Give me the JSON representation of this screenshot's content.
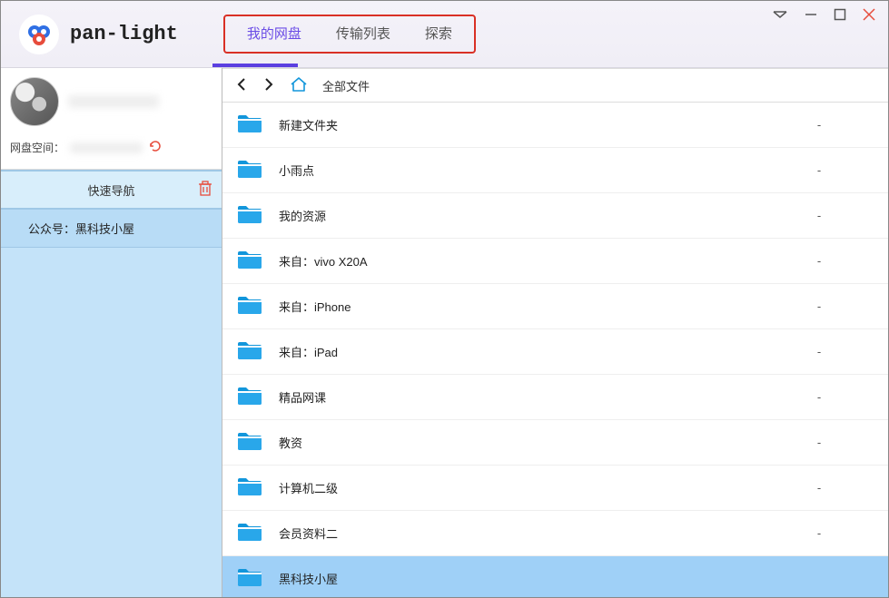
{
  "app": {
    "title": "pan-light"
  },
  "tabs": [
    {
      "label": "我的网盘",
      "active": true
    },
    {
      "label": "传输列表",
      "active": false
    },
    {
      "label": "探索",
      "active": false
    }
  ],
  "sidebar": {
    "storage_label": "网盘空间：",
    "quicknav_label": "快速导航",
    "wechat_label": "公众号：黑科技小屋"
  },
  "breadcrumb": {
    "root": "全部文件"
  },
  "files": [
    {
      "name": "新建文件夹",
      "meta": "-"
    },
    {
      "name": "小雨点",
      "meta": "-"
    },
    {
      "name": "我的资源",
      "meta": "-"
    },
    {
      "name": "来自：vivo X20A",
      "meta": "-"
    },
    {
      "name": "来自：iPhone",
      "meta": "-"
    },
    {
      "name": "来自：iPad",
      "meta": "-"
    },
    {
      "name": "精品网课",
      "meta": "-"
    },
    {
      "name": "教资",
      "meta": "-"
    },
    {
      "name": "计算机二级",
      "meta": "-"
    },
    {
      "name": "会员资料二",
      "meta": "-"
    },
    {
      "name": "黑科技小屋",
      "meta": "",
      "selected": true
    }
  ]
}
